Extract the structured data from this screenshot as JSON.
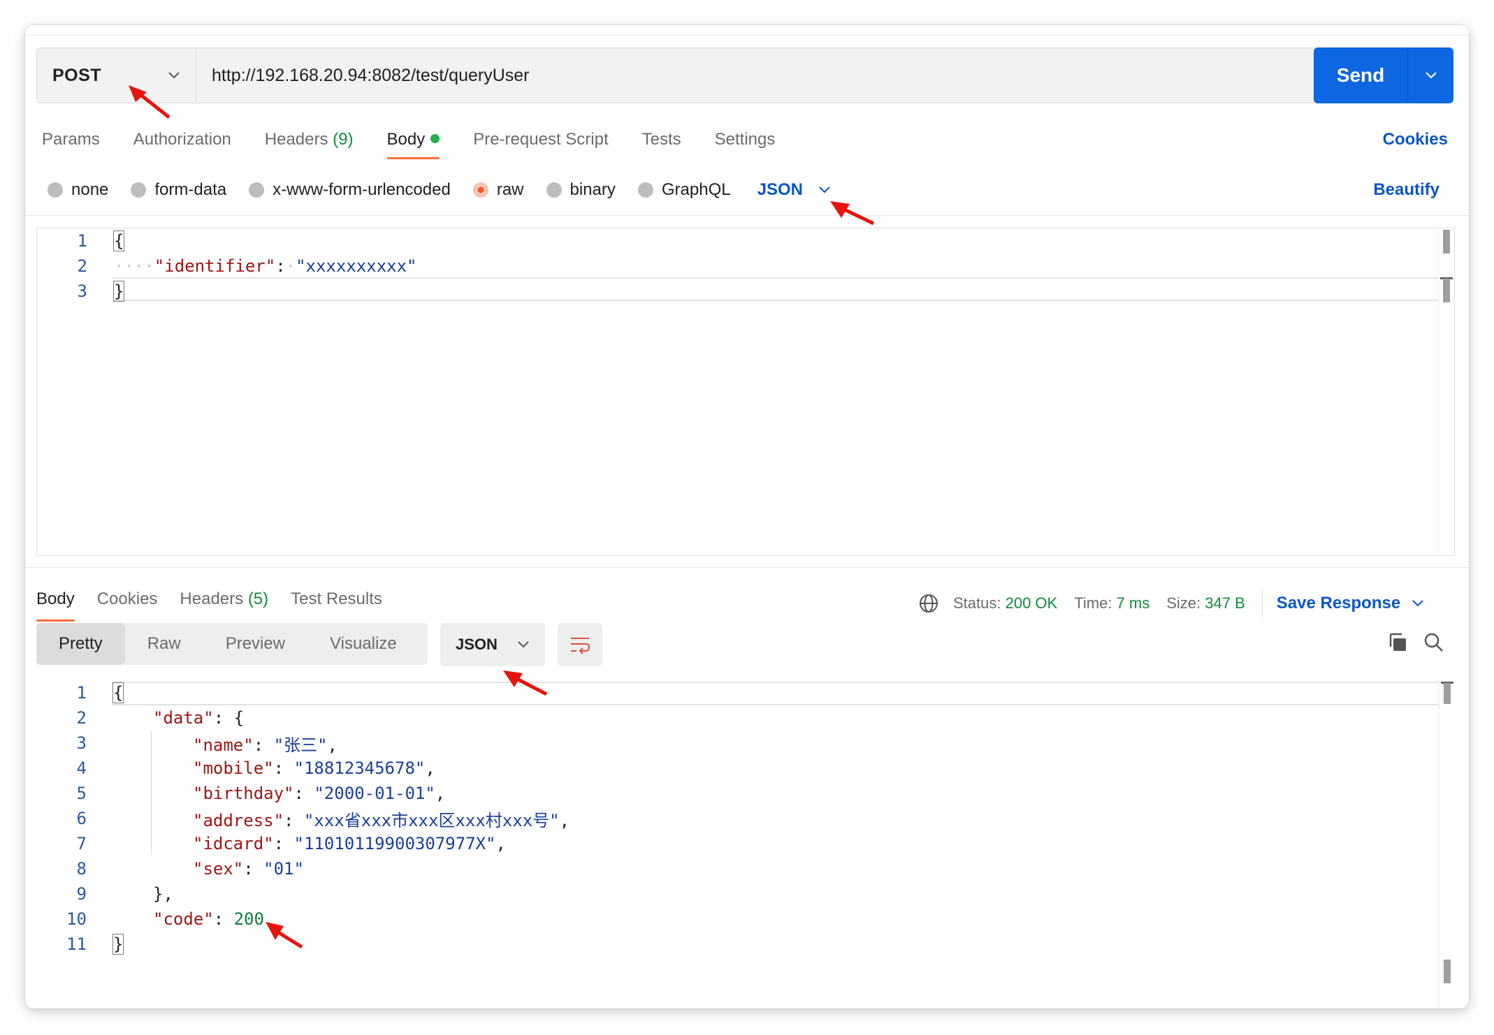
{
  "request": {
    "method": "POST",
    "url": "http://192.168.20.94:8082/test/queryUser",
    "send_label": "Send"
  },
  "request_tabs": [
    {
      "label": "Params"
    },
    {
      "label": "Authorization"
    },
    {
      "label": "Headers",
      "count": "(9)"
    },
    {
      "label": "Body"
    },
    {
      "label": "Pre-request Script"
    },
    {
      "label": "Tests"
    },
    {
      "label": "Settings"
    }
  ],
  "cookies_link": "Cookies",
  "body_types": [
    {
      "label": "none"
    },
    {
      "label": "form-data"
    },
    {
      "label": "x-www-form-urlencoded"
    },
    {
      "label": "raw",
      "checked": true
    },
    {
      "label": "binary"
    },
    {
      "label": "GraphQL"
    }
  ],
  "raw_format": "JSON",
  "beautify_label": "Beautify",
  "request_body": {
    "line_numbers": [
      "1",
      "2",
      "3"
    ],
    "open_brace": "{",
    "indent_dots": "····",
    "key": "\"identifier\"",
    "colon": ":",
    "value": "\"xxxxxxxxxx\"",
    "close_brace": "}"
  },
  "response_tabs": [
    {
      "label": "Body"
    },
    {
      "label": "Cookies"
    },
    {
      "label": "Headers",
      "count": "(5)"
    },
    {
      "label": "Test Results"
    }
  ],
  "response_meta": {
    "status_label": "Status:",
    "status_value": "200 OK",
    "time_label": "Time:",
    "time_value": "7 ms",
    "size_label": "Size:",
    "size_value": "347 B",
    "save_response": "Save Response"
  },
  "view_modes": [
    "Pretty",
    "Raw",
    "Preview",
    "Visualize"
  ],
  "response_format": "JSON",
  "response_body": {
    "line_numbers": [
      "1",
      "2",
      "3",
      "4",
      "5",
      "6",
      "7",
      "8",
      "9",
      "10",
      "11"
    ],
    "lines": [
      {
        "punct": "{"
      },
      {
        "key": "\"data\"",
        "punct": ": {"
      },
      {
        "key": "\"name\"",
        "value": "\"张三\"",
        "trail": ","
      },
      {
        "key": "\"mobile\"",
        "value": "\"18812345678\"",
        "trail": ","
      },
      {
        "key": "\"birthday\"",
        "value": "\"2000-01-01\"",
        "trail": ","
      },
      {
        "key": "\"address\"",
        "value": "\"xxx省xxx市xxx区xxx村xxx号\"",
        "trail": ","
      },
      {
        "key": "\"idcard\"",
        "value": "\"11010119900307977X\"",
        "trail": ","
      },
      {
        "key": "\"sex\"",
        "value": "\"01\""
      },
      {
        "punct": "},"
      },
      {
        "key": "\"code\"",
        "number": "200"
      },
      {
        "punct": "}"
      }
    ]
  },
  "colors": {
    "accent_blue": "#0c67e0",
    "link_blue": "#0b56c7",
    "tab_underline": "#ff6c37",
    "success_green": "#0f8c3c",
    "annotation_red": "#e8130c"
  }
}
